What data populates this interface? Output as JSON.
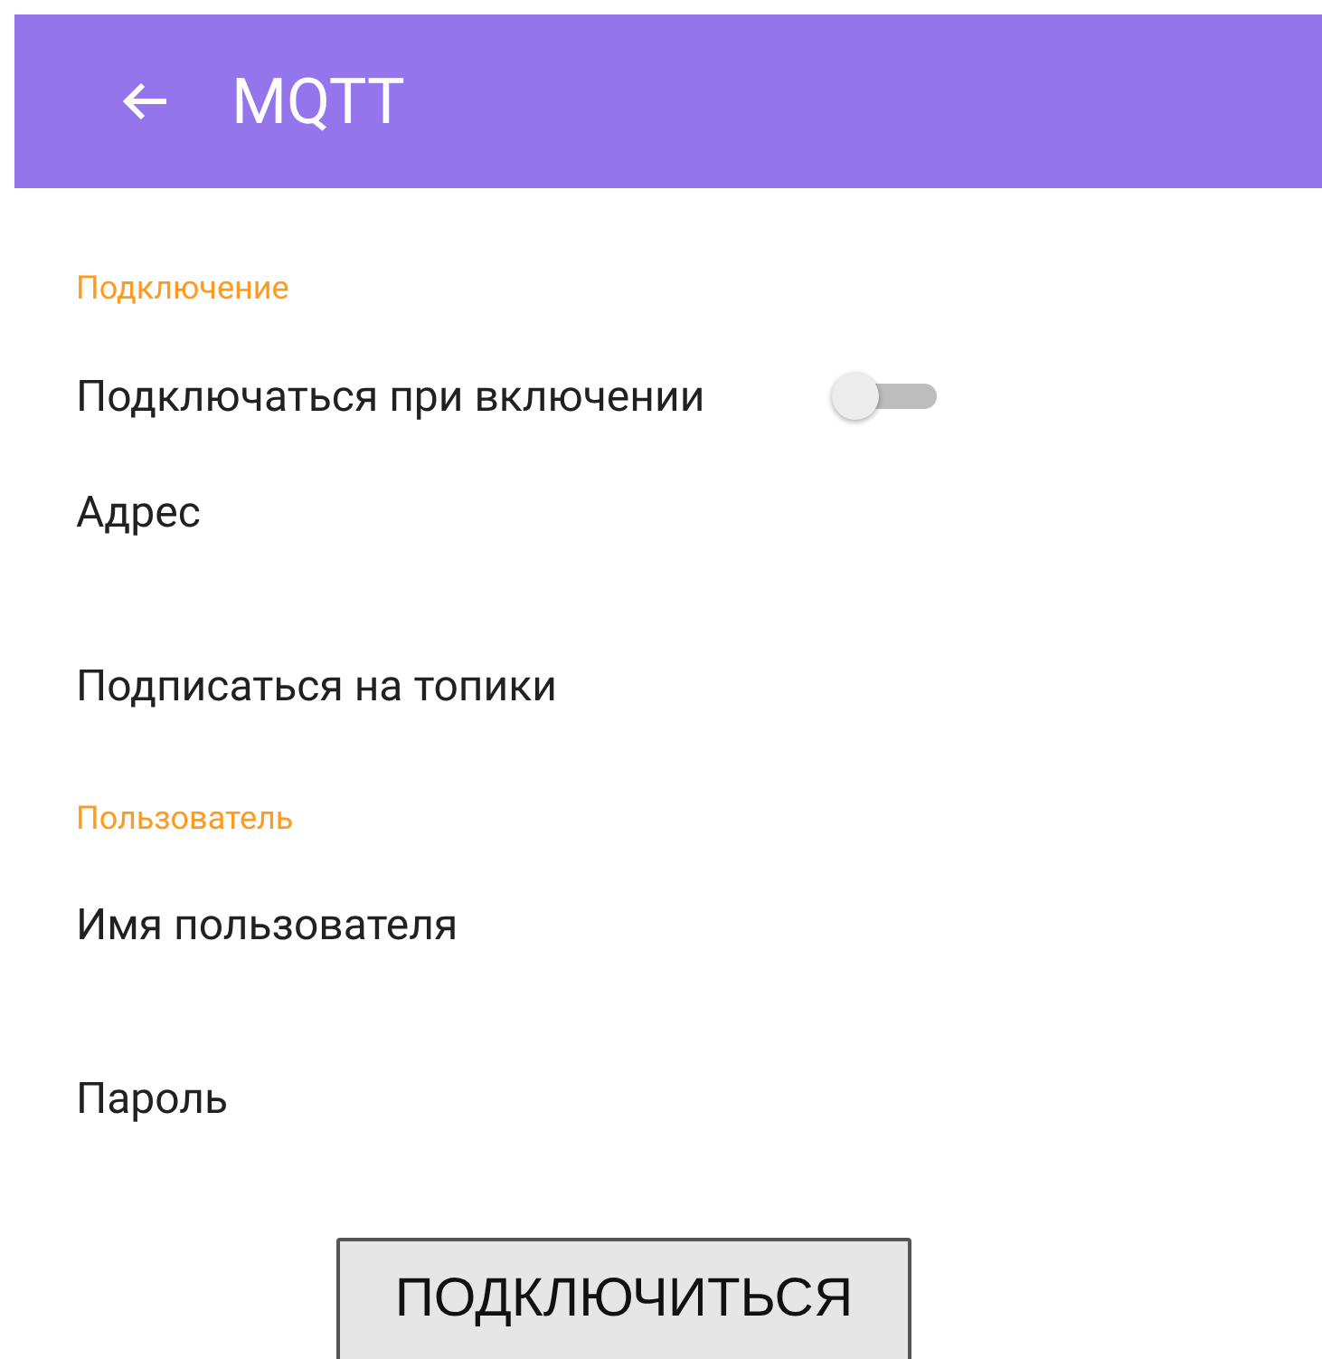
{
  "app_bar": {
    "title": "MQTT"
  },
  "sections": [
    {
      "header": "Подключение",
      "items": [
        {
          "kind": "switch",
          "title": "Подключаться при включении",
          "checked": false
        },
        {
          "kind": "field",
          "title": "Адрес"
        },
        {
          "kind": "action",
          "title": "Подписаться на топики"
        }
      ]
    },
    {
      "header": "Пользователь",
      "items": [
        {
          "kind": "field",
          "title": "Имя пользователя"
        },
        {
          "kind": "field",
          "title": "Пароль"
        }
      ]
    }
  ],
  "button": "ПОДКЛЮЧИТЬСЯ"
}
